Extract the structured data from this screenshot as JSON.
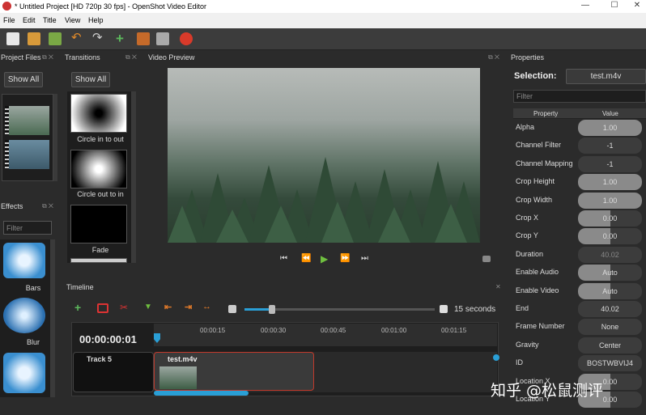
{
  "window": {
    "title": "* Untitled Project [HD 720p 30 fps] - OpenShot Video Editor",
    "minimize": "—",
    "maximize": "☐",
    "close": "✕"
  },
  "menu": {
    "file": "File",
    "edit": "Edit",
    "title": "Title",
    "view": "View",
    "help": "Help"
  },
  "colors": {
    "background": "#2b2b2b",
    "accent_blue": "#2a9fd6",
    "clip_border": "#c0392b",
    "playhead": "#2a9fd6"
  },
  "panels": {
    "project_files": {
      "title": "Project Files",
      "show_all": "Show All"
    },
    "transitions": {
      "title": "Transitions",
      "show_all": "Show All",
      "items": [
        "Circle in to out",
        "Circle out to in",
        "Fade"
      ]
    },
    "video_preview": {
      "title": "Video Preview"
    },
    "properties": {
      "title": "Properties",
      "selection_label": "Selection:",
      "selection_value": "test.m4v",
      "filter_placeholder": "Filter",
      "col_property": "Property",
      "col_value": "Value"
    },
    "effects": {
      "title": "Effects",
      "filter_placeholder": "Filter",
      "items": [
        "Bars",
        "Blur"
      ]
    },
    "timeline": {
      "title": "Timeline",
      "zoom_label": "15 seconds",
      "timecode": "00:00:00:01",
      "ticks": [
        "00:00:15",
        "00:00:30",
        "00:00:45",
        "00:01:00",
        "00:01:15"
      ],
      "track_name": "Track 5",
      "clip_name": "test.m4v"
    }
  },
  "properties": [
    {
      "name": "Alpha",
      "value": "1.00",
      "fill": 1.0
    },
    {
      "name": "Channel Filter",
      "value": "-1",
      "fill": 0
    },
    {
      "name": "Channel Mapping",
      "value": "-1",
      "fill": 0
    },
    {
      "name": "Crop Height",
      "value": "1.00",
      "fill": 1.0
    },
    {
      "name": "Crop Width",
      "value": "1.00",
      "fill": 1.0
    },
    {
      "name": "Crop X",
      "value": "0.00",
      "fill": 0.5
    },
    {
      "name": "Crop Y",
      "value": "0.00",
      "fill": 0.5
    },
    {
      "name": "Duration",
      "value": "40.02",
      "fill": 0
    },
    {
      "name": "Enable Audio",
      "value": "Auto",
      "fill": 0.5
    },
    {
      "name": "Enable Video",
      "value": "Auto",
      "fill": 0.5
    },
    {
      "name": "End",
      "value": "40.02",
      "fill": 0
    },
    {
      "name": "Frame Number",
      "value": "None",
      "fill": 0
    },
    {
      "name": "Gravity",
      "value": "Center",
      "fill": 0
    },
    {
      "name": "ID",
      "value": "BOSTWBVIJ4",
      "fill": 0
    },
    {
      "name": "Location X",
      "value": "0.00",
      "fill": 0.5
    },
    {
      "name": "Location Y",
      "value": "0.00",
      "fill": 0.5
    }
  ],
  "watermark": "知乎 @松鼠测评"
}
